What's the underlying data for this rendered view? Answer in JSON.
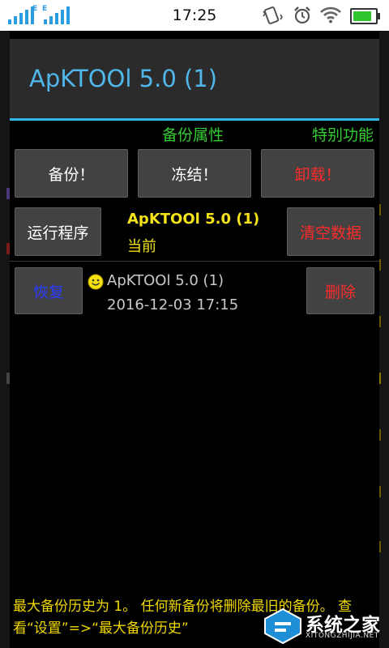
{
  "status_bar": {
    "time": "17:25",
    "sim1_label": "E",
    "sim2_label": "E",
    "battery_level": 0.9,
    "icons": [
      "signal-icon",
      "signal-icon",
      "vibrate-icon",
      "alarm-icon",
      "wifi-icon",
      "battery-icon"
    ]
  },
  "dialog": {
    "title": "ApKTOOl 5.0 (1)",
    "tabs": {
      "backup_props": "备份属性",
      "special": "特别功能"
    },
    "buttons": {
      "backup": "备份！",
      "freeze": "冻结！",
      "uninstall": "卸载！",
      "run": "运行程序",
      "clear_data": "清空数据",
      "restore": "恢复",
      "delete": "删除"
    },
    "app": {
      "name": "ApKTOOl 5.0 (1)",
      "status": "当前"
    },
    "backup_entry": {
      "name": "ApKTOOl 5.0 (1)",
      "date": "2016-12-03 17:15",
      "icon": "smiley-icon"
    },
    "footer_note": "最大备份历史为 1。 任何新备份将删除最旧的备份。 查看“设置”=>“最大备份历史”"
  },
  "watermark": {
    "text": "系统之家",
    "sub": "XITONGZHIJIA.NET"
  },
  "colors": {
    "accent": "#33b5e5",
    "title": "#4fb7ea",
    "tab_text": "#33cc33",
    "warning": "#ff2a2a",
    "restore": "#2a3cff",
    "highlight": "#f4e21a"
  }
}
